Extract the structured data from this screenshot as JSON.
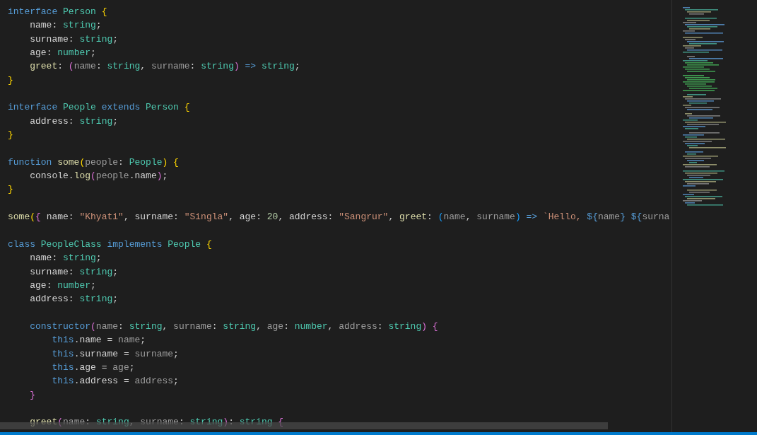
{
  "editor": {
    "lines": [
      {
        "kind": "code",
        "tokens": [
          {
            "kind": "kw",
            "text": "interface "
          },
          {
            "kind": "type",
            "text": "Person "
          },
          {
            "kind": "br1",
            "text": "{"
          }
        ]
      },
      {
        "kind": "code",
        "tokens": [
          {
            "kind": "prop",
            "text": "    name"
          },
          {
            "kind": "op",
            "text": ": "
          },
          {
            "kind": "type",
            "text": "string"
          },
          {
            "kind": "op",
            "text": ";"
          }
        ]
      },
      {
        "kind": "code",
        "tokens": [
          {
            "kind": "prop",
            "text": "    surname"
          },
          {
            "kind": "op",
            "text": ": "
          },
          {
            "kind": "type",
            "text": "string"
          },
          {
            "kind": "op",
            "text": ";"
          }
        ]
      },
      {
        "kind": "code",
        "tokens": [
          {
            "kind": "prop",
            "text": "    age"
          },
          {
            "kind": "op",
            "text": ": "
          },
          {
            "kind": "type",
            "text": "number"
          },
          {
            "kind": "op",
            "text": ";"
          }
        ]
      },
      {
        "kind": "code",
        "tokens": [
          {
            "kind": "fn",
            "text": "    greet"
          },
          {
            "kind": "op",
            "text": ": "
          },
          {
            "kind": "br2",
            "text": "("
          },
          {
            "kind": "param",
            "text": "name"
          },
          {
            "kind": "op",
            "text": ": "
          },
          {
            "kind": "type",
            "text": "string"
          },
          {
            "kind": "op",
            "text": ", "
          },
          {
            "kind": "param",
            "text": "surname"
          },
          {
            "kind": "op",
            "text": ": "
          },
          {
            "kind": "type",
            "text": "string"
          },
          {
            "kind": "br2",
            "text": ") "
          },
          {
            "kind": "kw",
            "text": "=> "
          },
          {
            "kind": "type",
            "text": "string"
          },
          {
            "kind": "op",
            "text": ";"
          }
        ]
      },
      {
        "kind": "code",
        "tokens": [
          {
            "kind": "br1",
            "text": "}"
          }
        ]
      },
      {
        "kind": "blank"
      },
      {
        "kind": "code",
        "tokens": [
          {
            "kind": "kw",
            "text": "interface "
          },
          {
            "kind": "type",
            "text": "People "
          },
          {
            "kind": "kw",
            "text": "extends "
          },
          {
            "kind": "type",
            "text": "Person "
          },
          {
            "kind": "br1",
            "text": "{"
          }
        ]
      },
      {
        "kind": "code",
        "tokens": [
          {
            "kind": "prop",
            "text": "    address"
          },
          {
            "kind": "op",
            "text": ": "
          },
          {
            "kind": "type",
            "text": "string"
          },
          {
            "kind": "op",
            "text": ";"
          }
        ]
      },
      {
        "kind": "code",
        "tokens": [
          {
            "kind": "br1",
            "text": "}"
          }
        ]
      },
      {
        "kind": "blank"
      },
      {
        "kind": "code",
        "tokens": [
          {
            "kind": "kw",
            "text": "function "
          },
          {
            "kind": "fn",
            "text": "some"
          },
          {
            "kind": "br1",
            "text": "("
          },
          {
            "kind": "param",
            "text": "people"
          },
          {
            "kind": "op",
            "text": ": "
          },
          {
            "kind": "type",
            "text": "People"
          },
          {
            "kind": "br1",
            "text": ") {"
          }
        ]
      },
      {
        "kind": "code",
        "tokens": [
          {
            "kind": "prop",
            "text": "    console"
          },
          {
            "kind": "op",
            "text": "."
          },
          {
            "kind": "fn",
            "text": "log"
          },
          {
            "kind": "br2",
            "text": "("
          },
          {
            "kind": "param",
            "text": "people"
          },
          {
            "kind": "op",
            "text": "."
          },
          {
            "kind": "prop",
            "text": "name"
          },
          {
            "kind": "br2",
            "text": ")"
          },
          {
            "kind": "op",
            "text": ";"
          }
        ]
      },
      {
        "kind": "code",
        "tokens": [
          {
            "kind": "br1",
            "text": "}"
          }
        ]
      },
      {
        "kind": "blank"
      },
      {
        "kind": "code",
        "tokens": [
          {
            "kind": "fn",
            "text": "some"
          },
          {
            "kind": "br1",
            "text": "("
          },
          {
            "kind": "br2",
            "text": "{ "
          },
          {
            "kind": "prop",
            "text": "name"
          },
          {
            "kind": "op",
            "text": ": "
          },
          {
            "kind": "str",
            "text": "\"Khyati\""
          },
          {
            "kind": "op",
            "text": ", "
          },
          {
            "kind": "prop",
            "text": "surname"
          },
          {
            "kind": "op",
            "text": ": "
          },
          {
            "kind": "str",
            "text": "\"Singla\""
          },
          {
            "kind": "op",
            "text": ", "
          },
          {
            "kind": "prop",
            "text": "age"
          },
          {
            "kind": "op",
            "text": ": "
          },
          {
            "kind": "num",
            "text": "20"
          },
          {
            "kind": "op",
            "text": ", "
          },
          {
            "kind": "prop",
            "text": "address"
          },
          {
            "kind": "op",
            "text": ": "
          },
          {
            "kind": "str",
            "text": "\"Sangrur\""
          },
          {
            "kind": "op",
            "text": ", "
          },
          {
            "kind": "fn",
            "text": "greet"
          },
          {
            "kind": "op",
            "text": ": "
          },
          {
            "kind": "br3",
            "text": "("
          },
          {
            "kind": "param",
            "text": "name"
          },
          {
            "kind": "op",
            "text": ", "
          },
          {
            "kind": "param",
            "text": "surname"
          },
          {
            "kind": "br3",
            "text": ") "
          },
          {
            "kind": "kw",
            "text": "=> "
          },
          {
            "kind": "str",
            "text": "`Hello, "
          },
          {
            "kind": "kw",
            "text": "${"
          },
          {
            "kind": "param",
            "text": "name"
          },
          {
            "kind": "kw",
            "text": "} ${"
          },
          {
            "kind": "param",
            "text": "surna"
          }
        ]
      },
      {
        "kind": "blank"
      },
      {
        "kind": "code",
        "tokens": [
          {
            "kind": "kw",
            "text": "class "
          },
          {
            "kind": "type",
            "text": "PeopleClass "
          },
          {
            "kind": "kw",
            "text": "implements "
          },
          {
            "kind": "type",
            "text": "People "
          },
          {
            "kind": "br1",
            "text": "{"
          }
        ]
      },
      {
        "kind": "code",
        "tokens": [
          {
            "kind": "prop",
            "text": "    name"
          },
          {
            "kind": "op",
            "text": ": "
          },
          {
            "kind": "type",
            "text": "string"
          },
          {
            "kind": "op",
            "text": ";"
          }
        ]
      },
      {
        "kind": "code",
        "tokens": [
          {
            "kind": "prop",
            "text": "    surname"
          },
          {
            "kind": "op",
            "text": ": "
          },
          {
            "kind": "type",
            "text": "string"
          },
          {
            "kind": "op",
            "text": ";"
          }
        ]
      },
      {
        "kind": "code",
        "tokens": [
          {
            "kind": "prop",
            "text": "    age"
          },
          {
            "kind": "op",
            "text": ": "
          },
          {
            "kind": "type",
            "text": "number"
          },
          {
            "kind": "op",
            "text": ";"
          }
        ]
      },
      {
        "kind": "code",
        "tokens": [
          {
            "kind": "prop",
            "text": "    address"
          },
          {
            "kind": "op",
            "text": ": "
          },
          {
            "kind": "type",
            "text": "string"
          },
          {
            "kind": "op",
            "text": ";"
          }
        ]
      },
      {
        "kind": "blank"
      },
      {
        "kind": "code",
        "tokens": [
          {
            "kind": "kw",
            "text": "    constructor"
          },
          {
            "kind": "br2",
            "text": "("
          },
          {
            "kind": "param",
            "text": "name"
          },
          {
            "kind": "op",
            "text": ": "
          },
          {
            "kind": "type",
            "text": "string"
          },
          {
            "kind": "op",
            "text": ", "
          },
          {
            "kind": "param",
            "text": "surname"
          },
          {
            "kind": "op",
            "text": ": "
          },
          {
            "kind": "type",
            "text": "string"
          },
          {
            "kind": "op",
            "text": ", "
          },
          {
            "kind": "param",
            "text": "age"
          },
          {
            "kind": "op",
            "text": ": "
          },
          {
            "kind": "type",
            "text": "number"
          },
          {
            "kind": "op",
            "text": ", "
          },
          {
            "kind": "param",
            "text": "address"
          },
          {
            "kind": "op",
            "text": ": "
          },
          {
            "kind": "type",
            "text": "string"
          },
          {
            "kind": "br2",
            "text": ") {"
          }
        ]
      },
      {
        "kind": "code",
        "tokens": [
          {
            "kind": "kw",
            "text": "        this"
          },
          {
            "kind": "op",
            "text": "."
          },
          {
            "kind": "prop",
            "text": "name"
          },
          {
            "kind": "op",
            "text": " = "
          },
          {
            "kind": "param",
            "text": "name"
          },
          {
            "kind": "op",
            "text": ";"
          }
        ]
      },
      {
        "kind": "code",
        "tokens": [
          {
            "kind": "kw",
            "text": "        this"
          },
          {
            "kind": "op",
            "text": "."
          },
          {
            "kind": "prop",
            "text": "surname"
          },
          {
            "kind": "op",
            "text": " = "
          },
          {
            "kind": "param",
            "text": "surname"
          },
          {
            "kind": "op",
            "text": ";"
          }
        ]
      },
      {
        "kind": "code",
        "tokens": [
          {
            "kind": "kw",
            "text": "        this"
          },
          {
            "kind": "op",
            "text": "."
          },
          {
            "kind": "prop",
            "text": "age"
          },
          {
            "kind": "op",
            "text": " = "
          },
          {
            "kind": "param",
            "text": "age"
          },
          {
            "kind": "op",
            "text": ";"
          }
        ]
      },
      {
        "kind": "code",
        "tokens": [
          {
            "kind": "kw",
            "text": "        this"
          },
          {
            "kind": "op",
            "text": "."
          },
          {
            "kind": "prop",
            "text": "address"
          },
          {
            "kind": "op",
            "text": " = "
          },
          {
            "kind": "param",
            "text": "address"
          },
          {
            "kind": "op",
            "text": ";"
          }
        ]
      },
      {
        "kind": "code",
        "tokens": [
          {
            "kind": "br2",
            "text": "    }"
          }
        ]
      },
      {
        "kind": "blank"
      },
      {
        "kind": "code",
        "tokens": [
          {
            "kind": "fn",
            "text": "    greet"
          },
          {
            "kind": "br2",
            "text": "("
          },
          {
            "kind": "param",
            "text": "name"
          },
          {
            "kind": "op",
            "text": ": "
          },
          {
            "kind": "type",
            "text": "string"
          },
          {
            "kind": "op",
            "text": ", "
          },
          {
            "kind": "param",
            "text": "surname"
          },
          {
            "kind": "op",
            "text": ": "
          },
          {
            "kind": "type",
            "text": "string"
          },
          {
            "kind": "br2",
            "text": ")"
          },
          {
            "kind": "op",
            "text": ": "
          },
          {
            "kind": "type",
            "text": "string "
          },
          {
            "kind": "br2",
            "text": "{"
          }
        ]
      }
    ]
  }
}
